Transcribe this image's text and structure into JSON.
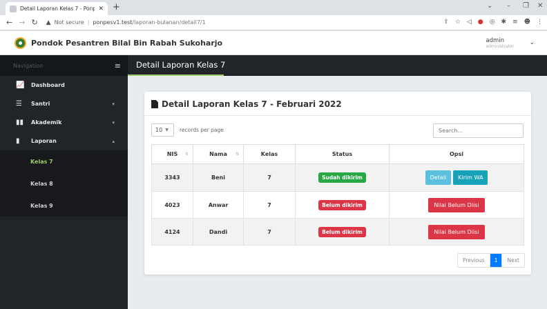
{
  "browser": {
    "tab_title": "Detail Laporan Kelas 7 - Ponpes",
    "new_tab": "+",
    "security": "Not secure",
    "url_host": "ponpesv1.test",
    "url_path": "/laporan-bulanan/detail7/1"
  },
  "header": {
    "brand": "Pondok Pesantren Bilal Bin Rabah Sukoharjo",
    "user_name": "admin",
    "user_role": "administrator"
  },
  "sidebar": {
    "title": "Navigation",
    "items": [
      {
        "label": "Dashboard",
        "icon": "chart-icon"
      },
      {
        "label": "Santri",
        "icon": "list-icon"
      },
      {
        "label": "Akademik",
        "icon": "book-icon"
      },
      {
        "label": "Laporan",
        "icon": "file-icon"
      }
    ],
    "submenu": [
      "Kelas 7",
      "Kelas 8",
      "Kelas 9"
    ]
  },
  "content": {
    "title": "Detail Laporan Kelas 7"
  },
  "card": {
    "title": "Detail Laporan Kelas 7 - Februari 2022",
    "length_value": "10",
    "length_label": "records per page",
    "search_placeholder": "Search..."
  },
  "table": {
    "headers": [
      "NIS",
      "Nama",
      "Kelas",
      "Status",
      "Opsi"
    ],
    "rows": [
      {
        "nis": "3343",
        "nama": "Beni",
        "kelas": "7",
        "status": "Sudah dikirim",
        "btn1": "Detail",
        "btn2": "Kirim WA"
      },
      {
        "nis": "4023",
        "nama": "Anwar",
        "kelas": "7",
        "status": "Belum dikirim",
        "btn1": "Nilai Belum Diisi"
      },
      {
        "nis": "4124",
        "nama": "Dandi",
        "kelas": "7",
        "status": "Belum dikirim",
        "btn1": "Nilai Belum Diisi"
      }
    ]
  },
  "pagination": {
    "previous": "Previous",
    "current": "1",
    "next": "Next"
  },
  "colors": {
    "sidebar_bg": "#212529",
    "accent_green": "#9ccc65",
    "success": "#28a745",
    "danger": "#dc3545",
    "info": "#17a2b8",
    "primary": "#007bff"
  }
}
